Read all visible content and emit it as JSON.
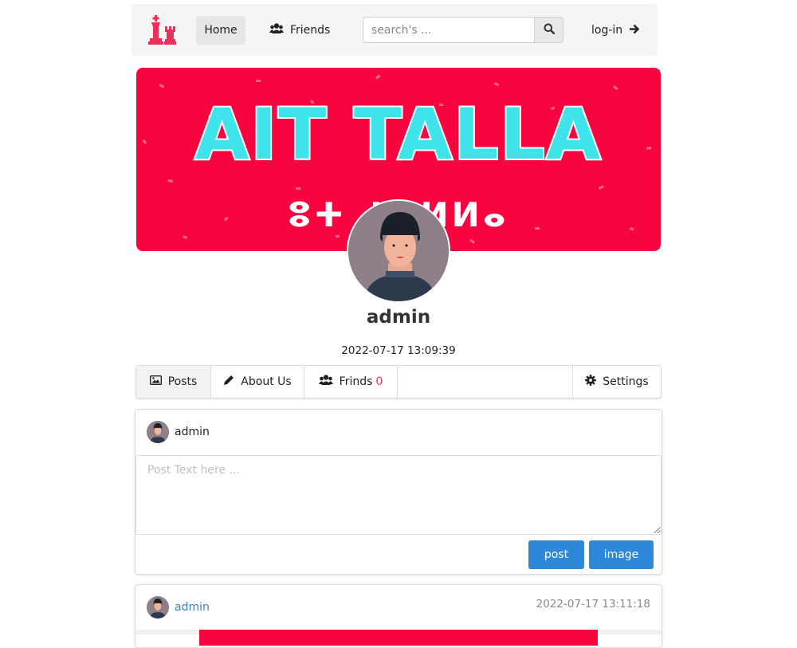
{
  "nav": {
    "home": "Home",
    "friends": "Friends",
    "search_placeholder": "search's ...",
    "login": "log-in"
  },
  "banner": {
    "title": "AIT TALLA",
    "subtitle": "ⵓⵜ ⵜⴰⵍⵍⴰ"
  },
  "profile": {
    "name": "admin",
    "joined": "2022-07-17 13:09:39"
  },
  "tabs": {
    "posts": "Posts",
    "about": "About Us",
    "friends": "Frinds",
    "friends_count": "0",
    "settings": "Settings"
  },
  "composer": {
    "author": "admin",
    "placeholder": "Post Text here ...",
    "post_button": "post",
    "image_button": "image"
  },
  "post": {
    "author": "admin",
    "timestamp": "2022-07-17 13:11:18"
  },
  "colors": {
    "accent": "#2e87d8",
    "banner": "#f8053f",
    "count": "#e8315a"
  }
}
